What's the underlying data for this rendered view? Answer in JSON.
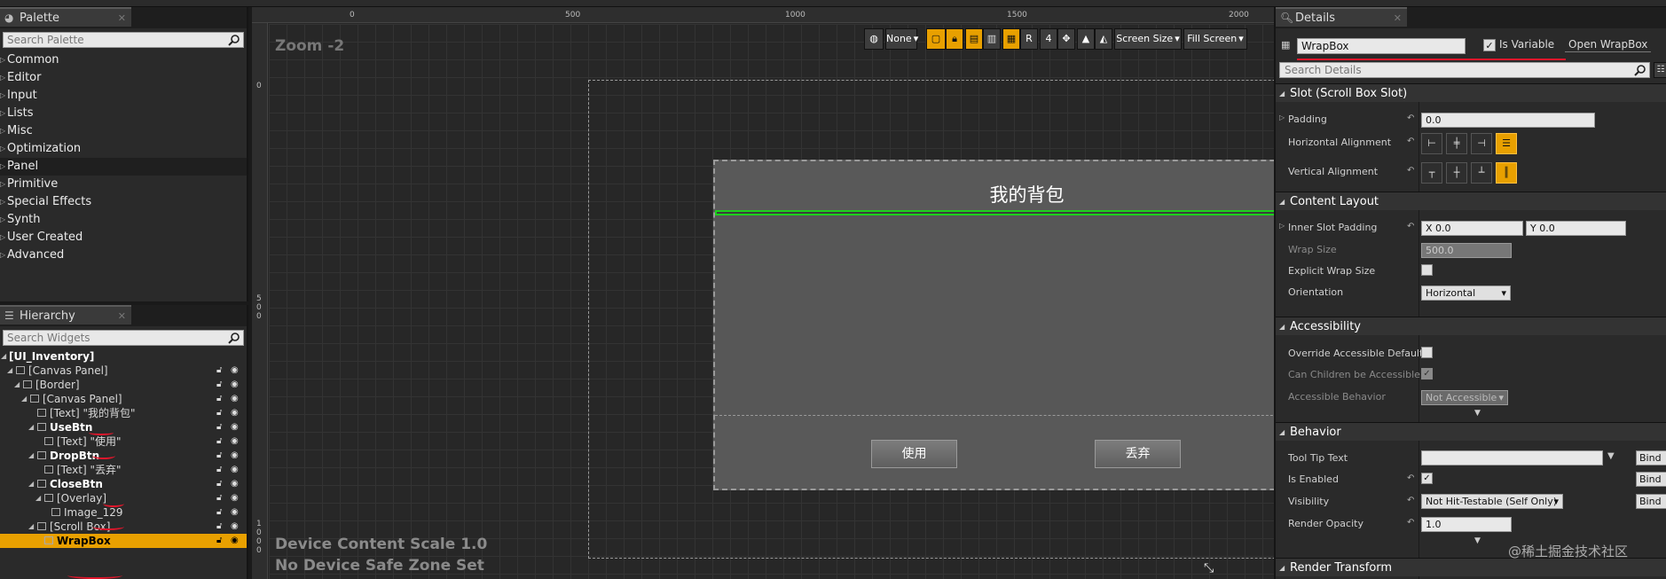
{
  "palette": {
    "tab_label": "Palette",
    "search_placeholder": "Search Palette",
    "categories": [
      "Common",
      "Editor",
      "Input",
      "Lists",
      "Misc",
      "Optimization",
      "Panel",
      "Primitive",
      "Special Effects",
      "Synth",
      "User Created",
      "Advanced"
    ]
  },
  "hierarchy": {
    "tab_label": "Hierarchy",
    "search_placeholder": "Search Widgets",
    "root": "[UI_Inventory]",
    "items": [
      {
        "label": "[Canvas Panel]"
      },
      {
        "label": "[Border]"
      },
      {
        "label": "[Canvas Panel]"
      },
      {
        "label": "[Text] \"我的背包\""
      },
      {
        "label": "UseBtn"
      },
      {
        "label": "[Text] \"使用\""
      },
      {
        "label": "DropBtn"
      },
      {
        "label": "[Text] \"丢弃\""
      },
      {
        "label": "CloseBtn"
      },
      {
        "label": "[Overlay]"
      },
      {
        "label": "Image_129"
      },
      {
        "label": "[Scroll Box]"
      },
      {
        "label": "WrapBox"
      }
    ]
  },
  "designer": {
    "zoom": "Zoom -2",
    "ruler_top": [
      "0",
      "500",
      "1000",
      "1500",
      "2000"
    ],
    "ruler_left": [
      "0",
      "5",
      "0",
      "0",
      "1",
      "0",
      "0",
      "0"
    ],
    "toolbar": {
      "none_label": "None",
      "r_label": "R",
      "four_label": "4",
      "screen_size": "Screen Size",
      "fill_screen": "Fill Screen"
    },
    "dialog_title": "我的背包",
    "use_button": "使用",
    "drop_button": "丢弃",
    "device_scale": "Device Content Scale 1.0",
    "safe_zone": "No Device Safe Zone Set"
  },
  "details": {
    "tab_label": "Details",
    "name_value": "WrapBox",
    "is_variable_label": "Is Variable",
    "open_label": "Open WrapBox",
    "search_placeholder": "Search Details",
    "sections": {
      "slot": "Slot (Scroll Box Slot)",
      "content_layout": "Content Layout",
      "accessibility": "Accessibility",
      "behavior": "Behavior",
      "render_transform": "Render Transform"
    },
    "padding_label": "Padding",
    "padding_value": "0.0",
    "h_align_label": "Horizontal Alignment",
    "v_align_label": "Vertical Alignment",
    "inner_slot_label": "Inner Slot Padding",
    "inner_x": "X  0.0",
    "inner_y": "Y  0.0",
    "wrap_size_label": "Wrap Size",
    "wrap_size_value": "500.0",
    "explicit_wrap_label": "Explicit Wrap Size",
    "orientation_label": "Orientation",
    "orientation_value": "Horizontal",
    "override_acc_label": "Override Accessible Default",
    "children_acc_label": "Can Children be Accessible",
    "acc_behavior_label": "Accessible Behavior",
    "acc_behavior_value": "Not Accessible",
    "tooltip_label": "Tool Tip Text",
    "enabled_label": "Is Enabled",
    "visibility_label": "Visibility",
    "visibility_value": "Not Hit-Testable (Self Only)",
    "opacity_label": "Render Opacity",
    "opacity_value": "1.0",
    "bind_label": "Bind"
  },
  "watermark": "@稀土掘金技术社区",
  "colors": {
    "accent": "#e8a000",
    "selection_line": "#1cd11c",
    "annotation": "#e0162b"
  }
}
